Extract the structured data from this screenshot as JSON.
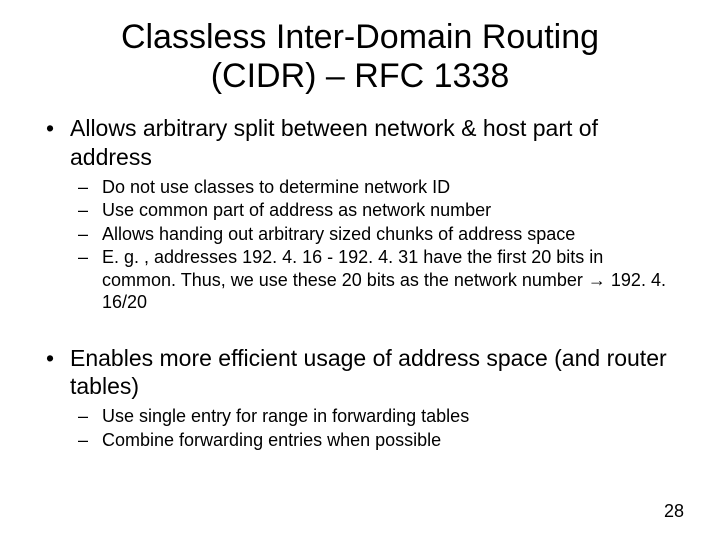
{
  "title_line1": "Classless Inter-Domain Routing",
  "title_line2": "(CIDR) – RFC 1338",
  "bullets": [
    {
      "text": "Allows arbitrary split between network & host part of address",
      "sub": [
        "Do not use classes to determine network ID",
        "Use common part of address as network number",
        "Allows handing out arbitrary sized chunks of address space",
        "E. g. , addresses 192. 4. 16 - 192. 4. 31 have the first 20 bits in common. Thus, we use these 20 bits as the network number → 192. 4. 16/20"
      ]
    },
    {
      "text": "Enables more efficient usage of address space (and router tables)",
      "sub": [
        "Use single entry for range in forwarding tables",
        "Combine forwarding entries when possible"
      ]
    }
  ],
  "page_number": "28"
}
